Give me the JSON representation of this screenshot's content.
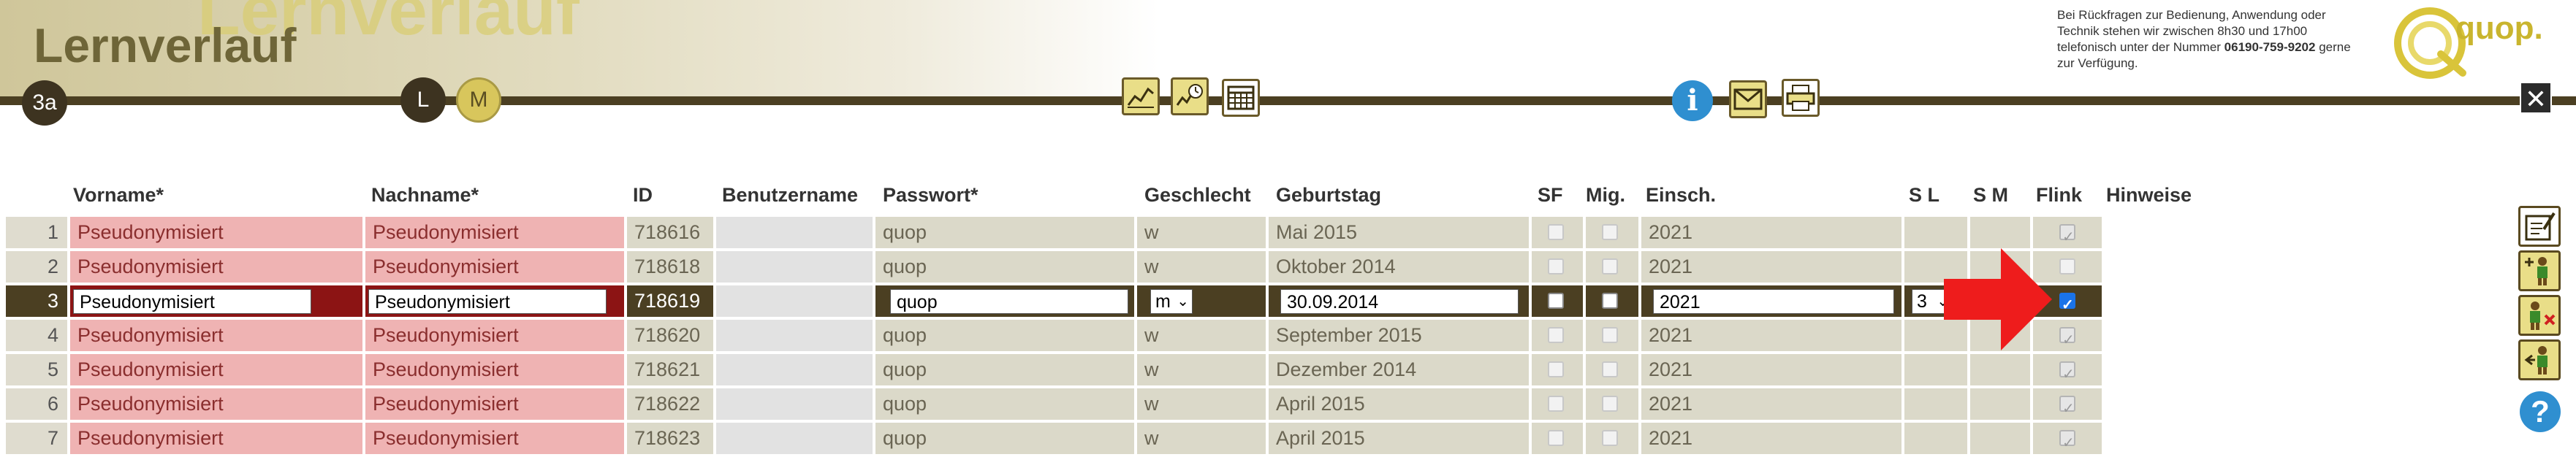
{
  "header": {
    "watermark_title": "Lernverlauf",
    "page_title": "Lernverlauf",
    "class_badge": "3a",
    "mode_l": "L",
    "mode_m": "M",
    "help_text_1": "Bei Rückfragen zur Bedienung, Anwendung oder Technik stehen wir zwischen 8h30 und 17h00 telefonisch unter der Nummer",
    "help_phone": "06190-759-9202",
    "help_text_2": "gerne zur Verfügung.",
    "logo_text": "quop.",
    "close_symbol": "✕",
    "info_symbol": "i"
  },
  "table": {
    "headers": {
      "vorname": "Vorname*",
      "nachname": "Nachname*",
      "id": "ID",
      "benutzername": "Benutzername",
      "passwort": "Passwort*",
      "geschlecht": "Geschlecht",
      "geburtstag": "Geburtstag",
      "sf": "SF",
      "mig": "Mig.",
      "einsch": "Einsch.",
      "sl": "S L",
      "sm": "S M",
      "flink": "Flink",
      "hinweise": "Hinweise"
    },
    "rows": [
      {
        "num": "1",
        "vorname": "Pseudonymisiert",
        "nachname": "Pseudonymisiert",
        "id": "718616",
        "passwort": "quop",
        "geschlecht": "w",
        "geburtstag": "Mai 2015",
        "einsch": "2021"
      },
      {
        "num": "2",
        "vorname": "Pseudonymisiert",
        "nachname": "Pseudonymisiert",
        "id": "718618",
        "passwort": "quop",
        "geschlecht": "w",
        "geburtstag": "Oktober 2014",
        "einsch": "2021"
      },
      {
        "num": "3",
        "vorname": "Pseudonymisiert",
        "nachname": "Pseudonymisiert",
        "id": "718619",
        "passwort": "quop",
        "geschlecht": "m",
        "geburtstag": "30.09.2014",
        "einsch": "2021",
        "sl": "3"
      },
      {
        "num": "4",
        "vorname": "Pseudonymisiert",
        "nachname": "Pseudonymisiert",
        "id": "718620",
        "passwort": "quop",
        "geschlecht": "w",
        "geburtstag": "September 2015",
        "einsch": "2021"
      },
      {
        "num": "5",
        "vorname": "Pseudonymisiert",
        "nachname": "Pseudonymisiert",
        "id": "718621",
        "passwort": "quop",
        "geschlecht": "w",
        "geburtstag": "Dezember 2014",
        "einsch": "2021"
      },
      {
        "num": "6",
        "vorname": "Pseudonymisiert",
        "nachname": "Pseudonymisiert",
        "id": "718622",
        "passwort": "quop",
        "geschlecht": "w",
        "geburtstag": "April 2015",
        "einsch": "2021"
      },
      {
        "num": "7",
        "vorname": "Pseudonymisiert",
        "nachname": "Pseudonymisiert",
        "id": "718623",
        "passwort": "quop",
        "geschlecht": "w",
        "geburtstag": "April 2015",
        "einsch": "2021"
      }
    ],
    "selected_row": "3"
  },
  "side_toolbar": {
    "help_symbol": "?"
  },
  "colors": {
    "accent_dark": "#4b3f22",
    "accent_gold": "#e9de88",
    "name_cell": "#efb3b3",
    "selected_name_cell": "#8c1414",
    "annotation_arrow": "#ee1c1c",
    "info_blue": "#2f8fd0"
  }
}
